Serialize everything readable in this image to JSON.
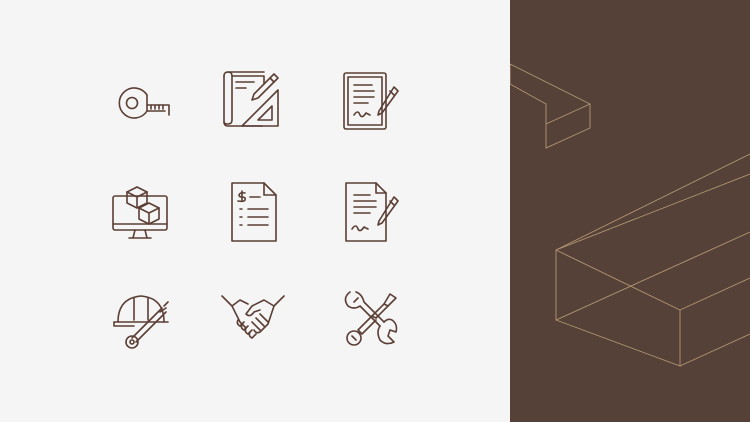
{
  "colors": {
    "background": "#f5f5f5",
    "icon_stroke": "#5b3e34",
    "brand_panel": "#554137",
    "brand_line": "#b39673"
  },
  "icons": [
    "tape-measure-icon",
    "blueprint-pencil-ruler-icon",
    "signed-contract-icon",
    "3d-model-monitor-icon",
    "invoice-document-icon",
    "document-signing-icon",
    "hard-hat-wrench-icon",
    "handshake-icon",
    "tools-wrench-screwdriver-icon"
  ]
}
